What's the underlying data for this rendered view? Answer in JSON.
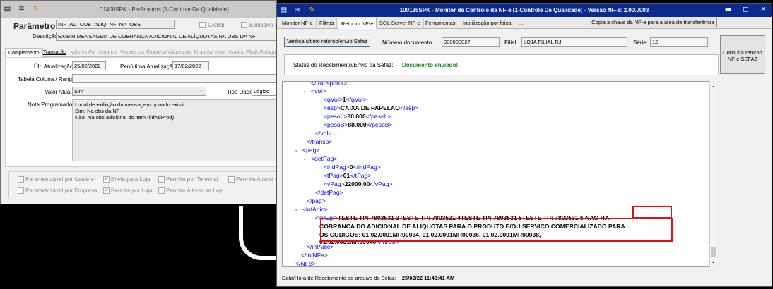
{
  "left_window": {
    "title": "01400SPK - Parâmetros (1-Controle De Qualidade)",
    "parametro_label": "Parâmetro",
    "parametro_value": "INF_AD_COB_ALIQ_NF_NA_OBS",
    "global_label": "Global",
    "exclusivo_label": "Exclusivo Li",
    "descricao_label": "Descrição",
    "descricao_value": "EXIBIR MENSAGEM DE COBRANÇA ADICIONAL DE ALÍQUOTAS NA OBS DA NF",
    "tabs": [
      "Complemento",
      "Transação",
      "Valores Por Usuários",
      "Valores por Empresa",
      "Valores por Empresa e por Usuário",
      "Filiais Retagua"
    ],
    "ult_atualizacao_label": "Últ. Atualização",
    "ult_atualizacao_value": "25/02/2022",
    "penultima_label": "Penúltima Atualização",
    "penultima_value": "17/02/2022",
    "tabela_coluna_label": "Tabela.Coluna / Range",
    "valor_atual_label": "Valor Atual",
    "valor_atual_value": "Sim",
    "tipo_dado_label": "Tipo Dado",
    "tipo_dado_value": "Lógico",
    "nota_label": "Nota Programador",
    "nota_lines": [
      "Local de exibição da mensagem quando existir:",
      "Sim: Na obs da NF",
      "Não: Na obs adicional do item (infAdProd)"
    ],
    "checks": {
      "parametrizavel_usuario": "Parametrizável por Usuário",
      "envia_para_loja": "Envia para Loja",
      "permite_terminal": "Permite por Terminal",
      "permite_alterar_n": "Permite Alterar n",
      "parametrizavel_empresa": "Parametrizável por Empresa",
      "permite_loja": "Permite por Loja",
      "permite_alterar_loja": "Permite Alterar na Loja"
    }
  },
  "right_window": {
    "title": "100135SPK - Monitor de Controle da NF-e (1-Controle De Qualidade) - Versão NF-e: 2.00.0003",
    "tabs": [
      "Monitor NF-e",
      "Filtros",
      "Retorno NF-e",
      "SQL Server NF-e",
      "Ferramentas",
      "Inutilização por faixa",
      "..."
    ],
    "copy_button": "Copia a chave da NF-e para a área de transferência",
    "verify_button": "Verifica último retorno/envio Sefaz",
    "numero_doc_label": "Número documento",
    "numero_doc_value": "000000027",
    "filial_label": "Filial",
    "filial_value": "LOJA FILIAL RJ",
    "serie_label": "Série",
    "serie_value": "12",
    "consulta_button_line1": "Consulta retorno",
    "consulta_button_line2": "NF-e SEFAZ",
    "status_label": "Status do Recebimento/Envio da Sefaz:",
    "status_value": "Documento enviado!",
    "status_color": "#118811",
    "footer_label": "Data/Hora de Recebimento do arquivo da Sefaz:",
    "footer_value": "25/02/22 11:40:41 AM",
    "xml": {
      "l0": "</transporta>",
      "l1_open": "<vol>",
      "qvol": [
        "<qVol>",
        "1",
        "</qVol>"
      ],
      "esp": [
        "<esp>",
        "CAIXA DE PAPELAO",
        "</esp>"
      ],
      "pesol": [
        "<pesoL>",
        "80.000",
        "</pesoL>"
      ],
      "pesob": [
        "<pesoB>",
        "88.000",
        "</pesoB>"
      ],
      "vol_close": "</vol>",
      "transp_close": "</transp>",
      "pag_open": "<pag>",
      "detpag_open": "<detPag>",
      "indpag": [
        "<indPag>",
        "0",
        "</indPag>"
      ],
      "tpag": [
        "<tPag>",
        "01",
        "</tPag>"
      ],
      "vpag": [
        "<vPag>",
        "22000.00",
        "</vPag>"
      ],
      "detpag_close": "</detPag>",
      "pag_close": "</pag>",
      "infadic_open": "<infAdic>",
      "infcpl_open": "<infCpl>",
      "infcpl_line1": "TESTE TP: 7803531 3TESTE TP: 7803531 4TESTE TP: 7803531 5TESTE TP: 7803531 6",
      "infcpl_highlight1": "NAO HA",
      "infcpl_line2": "COBRANCA DO ADICIONAL DE ALIQUOTAS PARA O PRODUTO E/OU SERVICO COMERCIALIZADO PARA",
      "infcpl_line3": "OS CODIGOS: 01.02.0001MR00034, 01.02.0001MR00036, 01.02.0001MR00038,",
      "infcpl_line4": "01.02.0001MR00040",
      "infcpl_close": "</infCpl>",
      "infadic_close": "</infAdic>",
      "infnfe_close": "</infNFe>",
      "nfe_close": "</NFe>",
      "dash": "-"
    }
  }
}
